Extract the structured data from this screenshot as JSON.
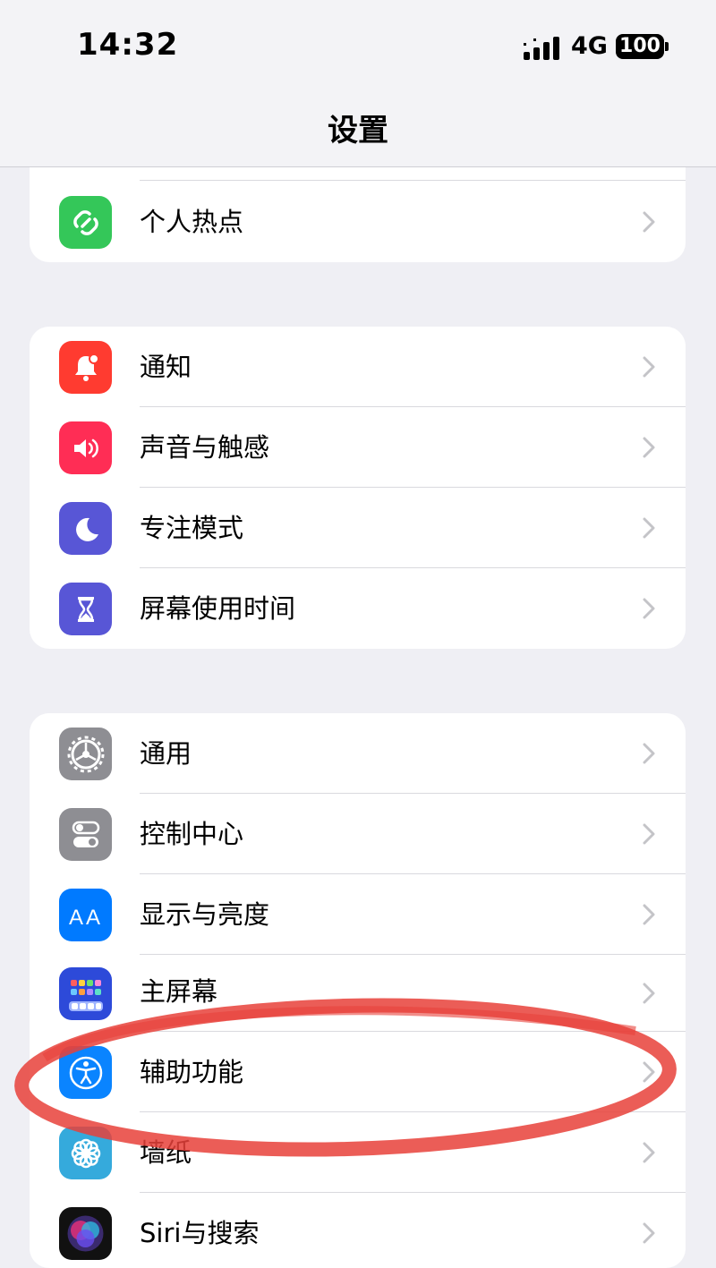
{
  "status_bar": {
    "time": "14:32",
    "network": "4G",
    "battery": "100"
  },
  "nav": {
    "title": "设置"
  },
  "group1": [
    {
      "label": "个人热点",
      "icon": "hotspot-icon",
      "color": "#34c759"
    }
  ],
  "group2": [
    {
      "label": "通知",
      "icon": "bell-icon",
      "color": "#ff3b30"
    },
    {
      "label": "声音与触感",
      "icon": "speaker-icon",
      "color": "#ff2d55"
    },
    {
      "label": "专注模式",
      "icon": "moon-icon",
      "color": "#5856d6"
    },
    {
      "label": "屏幕使用时间",
      "icon": "hourglass-icon",
      "color": "#5856d6"
    }
  ],
  "group3": [
    {
      "label": "通用",
      "icon": "gear-icon",
      "color": "#8e8e93"
    },
    {
      "label": "控制中心",
      "icon": "toggles-icon",
      "color": "#8e8e93"
    },
    {
      "label": "显示与亮度",
      "icon": "text-size-icon",
      "color": "#007aff"
    },
    {
      "label": "主屏幕",
      "icon": "home-grid-icon",
      "color": "#2d4ad9"
    },
    {
      "label": "辅助功能",
      "icon": "accessibility-icon",
      "color": "#0a84ff"
    },
    {
      "label": "墙纸",
      "icon": "flower-icon",
      "color": "#35aadc"
    },
    {
      "label": "Siri与搜索",
      "icon": "siri-icon",
      "color": "#222222"
    }
  ],
  "annotation": {
    "color": "#e8413a"
  }
}
